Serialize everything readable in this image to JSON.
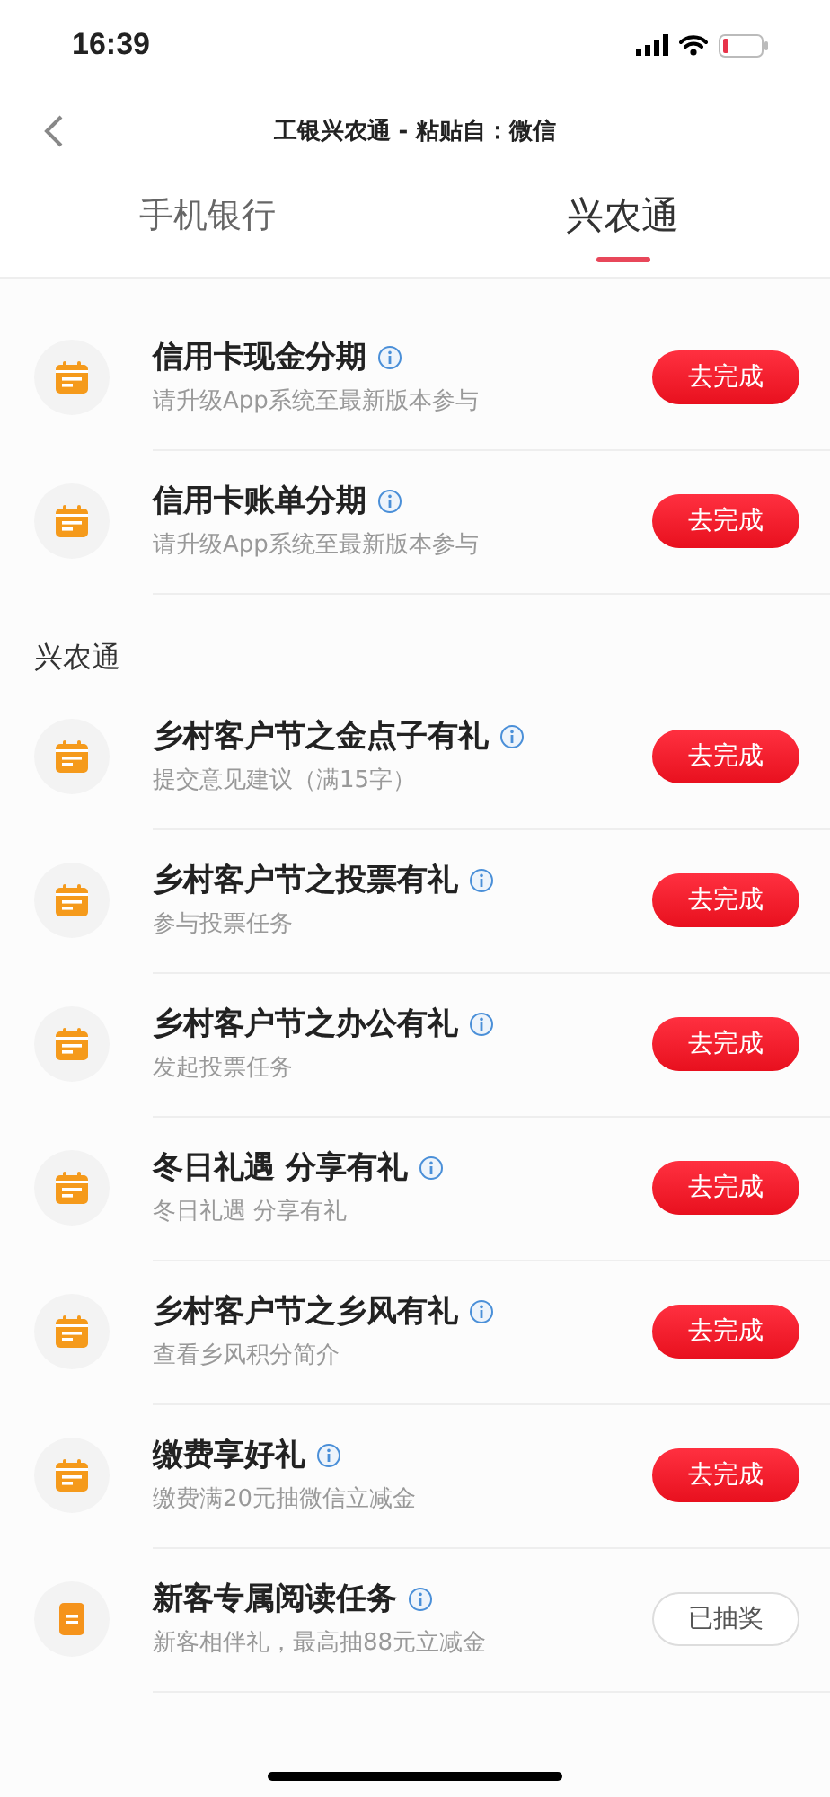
{
  "status_bar": {
    "time": "16:39"
  },
  "header": {
    "title": "工银兴农通 - 粘贴自：微信"
  },
  "tabs": [
    {
      "label": "手机银行",
      "selected": false
    },
    {
      "label": "兴农通",
      "selected": true
    }
  ],
  "sections": [
    {
      "tasks": [
        {
          "title": "信用卡现金分期",
          "subtitle": "请升级App系统至最新版本参与",
          "kind": "calendar",
          "completed": false,
          "button": "去完成"
        },
        {
          "title": "信用卡账单分期",
          "subtitle": "请升级App系统至最新版本参与",
          "kind": "calendar",
          "completed": false,
          "button": "去完成"
        }
      ]
    },
    {
      "heading": "兴农通",
      "tasks": [
        {
          "title": "乡村客户节之金点子有礼",
          "subtitle": "提交意见建议（满15字）",
          "kind": "calendar",
          "completed": false,
          "button": "去完成"
        },
        {
          "title": "乡村客户节之投票有礼",
          "subtitle": "参与投票任务",
          "kind": "calendar",
          "completed": false,
          "button": "去完成"
        },
        {
          "title": "乡村客户节之办公有礼",
          "subtitle": "发起投票任务",
          "kind": "calendar",
          "completed": false,
          "button": "去完成"
        },
        {
          "title": "冬日礼遇 分享有礼",
          "subtitle": "冬日礼遇 分享有礼",
          "kind": "calendar",
          "completed": false,
          "button": "去完成"
        },
        {
          "title": "乡村客户节之乡风有礼",
          "subtitle": "查看乡风积分简介",
          "kind": "calendar",
          "completed": false,
          "button": "去完成"
        },
        {
          "title": "缴费享好礼",
          "subtitle": "缴费满20元抽微信立减金",
          "kind": "calendar",
          "completed": false,
          "button": "去完成"
        },
        {
          "title": "新客专属阅读任务",
          "subtitle": "新客相伴礼，最高抽88元立减金",
          "kind": "document",
          "completed": true,
          "button": "已抽奖"
        }
      ]
    }
  ]
}
